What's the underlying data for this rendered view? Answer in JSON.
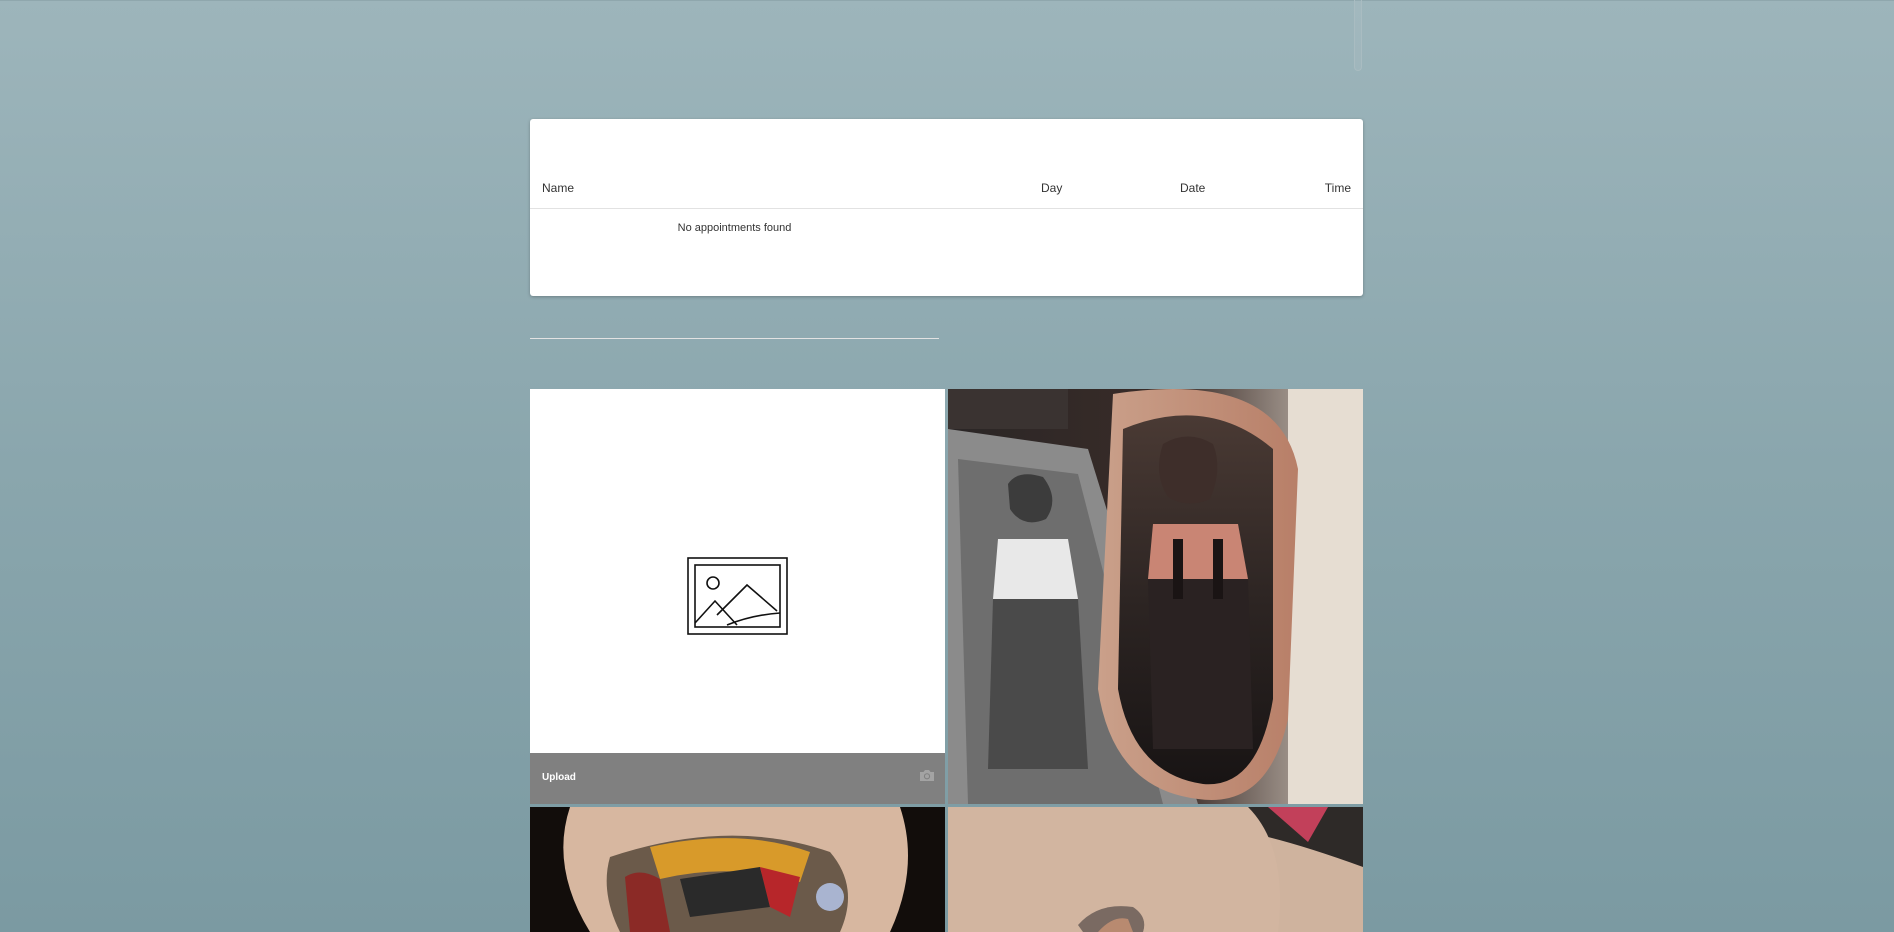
{
  "appointments": {
    "columns": {
      "name": "Name",
      "day": "Day",
      "date": "Date",
      "time": "Time"
    },
    "empty_message": "No appointments found"
  },
  "gallery": {
    "upload_label": "Upload",
    "upload_placeholder_icon": "image-placeholder-icon",
    "upload_action_icon": "camera-icon",
    "photos": [
      {
        "kind": "tattoo-photo",
        "subject": "vintage monkey portrait tattoo"
      },
      {
        "kind": "tattoo-photo",
        "subject": "colorful helmet tattoo"
      },
      {
        "kind": "tattoo-photo",
        "subject": "arm tattoo"
      }
    ]
  },
  "colors": {
    "background_top": "#9db5bb",
    "background_bottom": "#7b9aa2",
    "upload_bar": "#808080"
  }
}
